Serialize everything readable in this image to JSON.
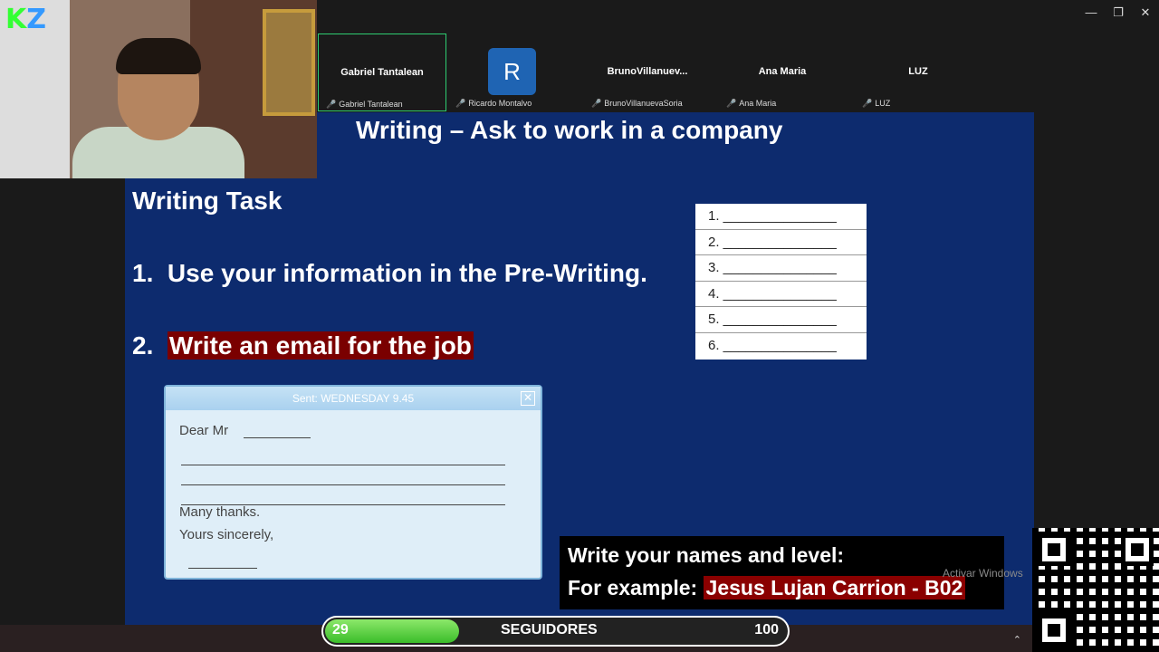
{
  "window": {
    "controls": [
      "—",
      "❐",
      "✕"
    ]
  },
  "participants": [
    {
      "display": "Gabriel Tantalean",
      "label": "Gabriel Tantalean",
      "active": true
    },
    {
      "display": "R",
      "label": "Ricardo Montalvo",
      "active": false
    },
    {
      "display": "BrunoVillanuev...",
      "label": "BrunoVillanuevaSoria",
      "active": false
    },
    {
      "display": "Ana Maria",
      "label": "Ana Maria",
      "active": false
    },
    {
      "display": "LUZ",
      "label": "LUZ",
      "active": false
    }
  ],
  "slide": {
    "title": "Writing – Ask to work in a company",
    "task_heading": "Writing Task",
    "point1_num": "1.",
    "point1_text": "Use your information in the Pre-Writing.",
    "point2_num": "2.",
    "point2_text": "Write an email for the job",
    "numbered_list": [
      "1. _______________",
      "2. _______________",
      "3. _______________",
      "4. _______________",
      "5. _______________",
      "6. _______________"
    ],
    "email": {
      "header": "Sent: WEDNESDAY 9.45",
      "greeting": "Dear Mr",
      "thanks": "Many thanks.",
      "closing": "Yours sincerely,"
    },
    "names_box": {
      "line1": "Write your names and level:",
      "line2_prefix": "For example:",
      "line2_example": "Jesus Lujan Carrion - B02"
    }
  },
  "watermark": "Activar Windows",
  "followers": {
    "current": "29",
    "label": "SEGUIDORES",
    "goal": "100",
    "progress": 0.29
  },
  "colors": {
    "slide_bg": "#0d2b6e",
    "highlight": "#7a0000",
    "active_tile": "#2ecc71",
    "avatar": "#1f64b3"
  }
}
